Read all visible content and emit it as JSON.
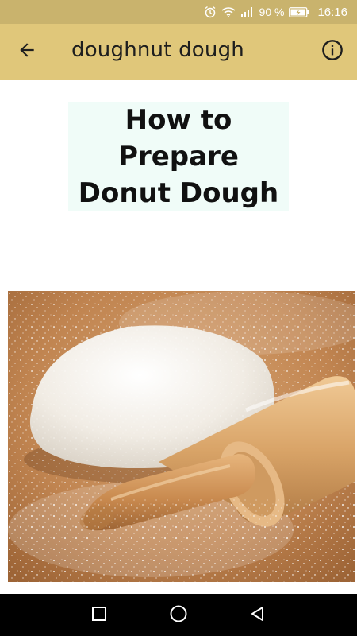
{
  "status_bar": {
    "battery_percent": "90 %",
    "time": "16:16",
    "icons": [
      "alarm-icon",
      "wifi-icon",
      "signal-icon",
      "battery-icon"
    ]
  },
  "app_bar": {
    "title": "doughnut dough",
    "back_icon": "arrow-back-icon",
    "info_icon": "info-icon",
    "colors": {
      "status": "#c9b36d",
      "toolbar": "#e0c77a"
    }
  },
  "content": {
    "heading_line1": "How to Prepare",
    "heading_line2": "Donut Dough",
    "heading_highlight": "#f0fcf8",
    "image": {
      "subject": "dough ball with wooden rolling pin on floured board"
    }
  },
  "nav_bar": {
    "icons": [
      "recent-apps-icon",
      "home-icon",
      "back-icon"
    ]
  }
}
